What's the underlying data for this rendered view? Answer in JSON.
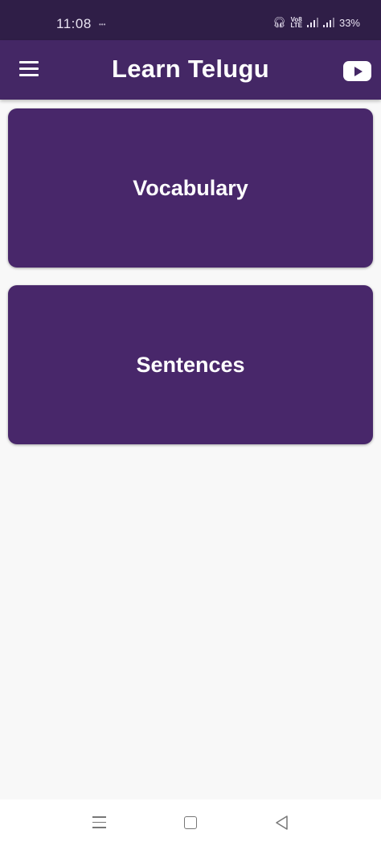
{
  "status_bar": {
    "time": "11:08",
    "battery": "33%",
    "network_badge": "VoB LTE"
  },
  "app_bar": {
    "title": "Learn Telugu",
    "menu_icon": "hamburger-menu-icon",
    "youtube_icon": "youtube-icon"
  },
  "cards": [
    {
      "label": "Vocabulary"
    },
    {
      "label": "Sentences"
    }
  ],
  "nav_bar": {
    "icons": [
      "recents-icon",
      "home-icon",
      "back-icon"
    ]
  },
  "colors": {
    "app_bar": "#442765",
    "status_bar": "#2f1e47",
    "card": "#48276a",
    "background": "#f8f8f8"
  }
}
